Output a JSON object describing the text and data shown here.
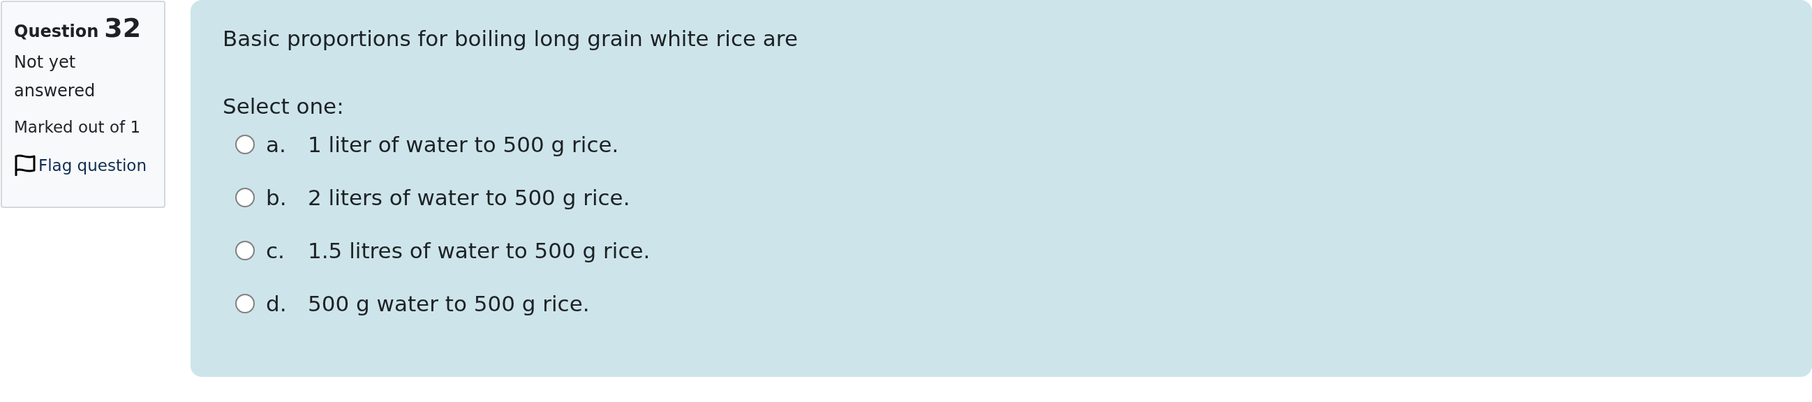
{
  "info": {
    "question_label": "Question",
    "question_number": "32",
    "state": "Not yet answered",
    "grade": "Marked out of 1",
    "flag_link": "Flag question"
  },
  "question": {
    "text": "Basic proportions for boiling long grain white rice are",
    "prompt": "Select one:",
    "options": [
      {
        "letter": "a.",
        "text": "1 liter of water to 500 g rice.",
        "selected": false
      },
      {
        "letter": "b.",
        "text": "2 liters of water to 500 g rice.",
        "selected": false
      },
      {
        "letter": "c.",
        "text": "1.5 litres of water to 500 g rice.",
        "selected": false
      },
      {
        "letter": "d.",
        "text": "500 g water to 500 g rice.",
        "selected": false
      }
    ]
  }
}
